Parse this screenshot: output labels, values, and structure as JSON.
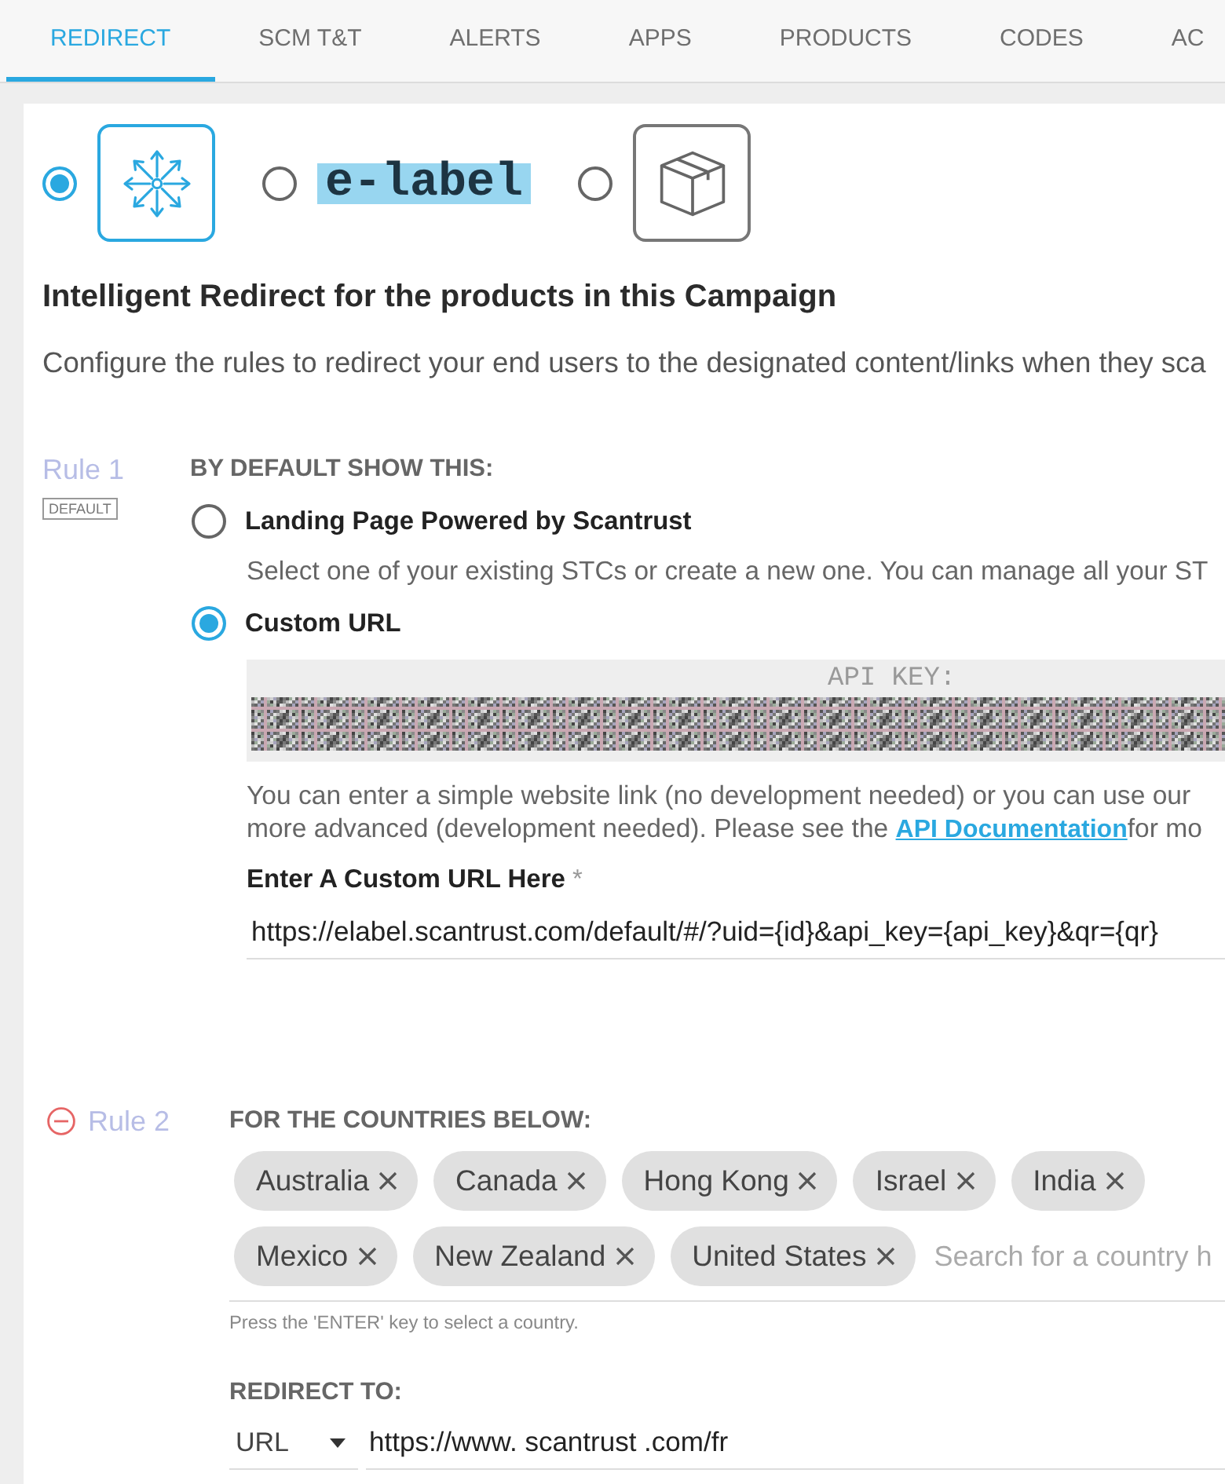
{
  "tabs": [
    {
      "label": "REDIRECT",
      "selected": true
    },
    {
      "label": "SCM T&T",
      "selected": false
    },
    {
      "label": "ALERTS",
      "selected": false
    },
    {
      "label": "APPS",
      "selected": false
    },
    {
      "label": "PRODUCTS",
      "selected": false
    },
    {
      "label": "CODES",
      "selected": false
    },
    {
      "label": "AC",
      "selected": false
    }
  ],
  "redirect_types": [
    {
      "kind": "arrows",
      "selected": true
    },
    {
      "kind": "wordmark",
      "label": "e-label",
      "selected": false
    },
    {
      "kind": "box",
      "selected": false
    }
  ],
  "heading": "Intelligent Redirect for the products in this Campaign",
  "description": "Configure the rules to redirect your end users to the designated content/links when they sca",
  "rules": [
    {
      "kind": "default",
      "label": "Rule 1",
      "tag": "DEFAULT",
      "removable": false,
      "title": "BY DEFAULT SHOW THIS:",
      "options": [
        {
          "label": "Landing Page Powered by Scantrust",
          "selected": false,
          "help": "Select one of your existing STCs or create a new one. You can manage all your ST"
        },
        {
          "label": "Custom URL",
          "selected": true
        }
      ],
      "api_key": {
        "label": "API KEY:"
      },
      "info": {
        "line_1": "You can enter a simple website link (no development needed) or you can use our",
        "line_2": "more advanced (development needed). Please see the ",
        "link": "API Documentation",
        "line_2_end": "for mo"
      },
      "url_field": {
        "label": "Enter A Custom URL Here",
        "required_mark": "*",
        "value": "https://elabel.scantrust.com/default/#/?uid={id}&api_key={api_key}&qr={qr}"
      }
    },
    {
      "kind": "countries",
      "label": "Rule 2",
      "removable": true,
      "title": "FOR THE COUNTRIES BELOW:",
      "countries": [
        "Australia",
        "Canada",
        "Hong Kong",
        "Israel",
        "India",
        "Mexico",
        "New Zealand",
        "United States"
      ],
      "search": {
        "placeholder": "Search for a country h"
      },
      "hint": "Press the 'ENTER' key to select a country.",
      "redirect": {
        "title": "REDIRECT TO:",
        "type": "URL",
        "value": "https://www. scantrust .com/fr"
      }
    }
  ]
}
